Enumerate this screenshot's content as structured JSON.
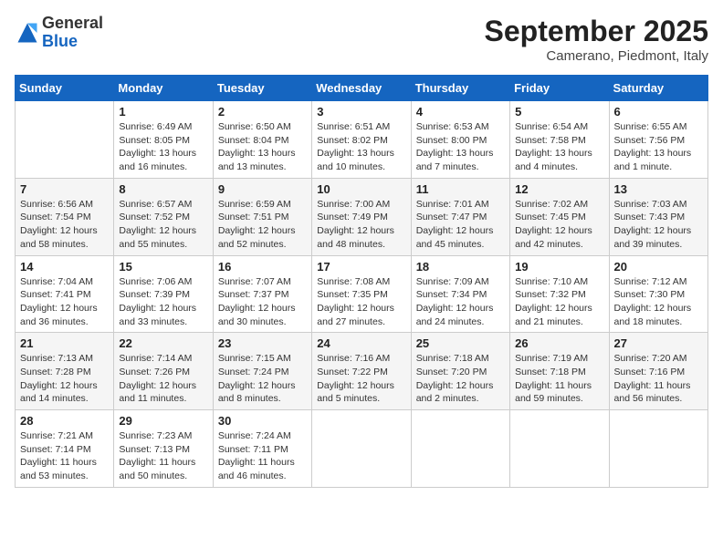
{
  "logo": {
    "general": "General",
    "blue": "Blue"
  },
  "title": "September 2025",
  "location": "Camerano, Piedmont, Italy",
  "days_of_week": [
    "Sunday",
    "Monday",
    "Tuesday",
    "Wednesday",
    "Thursday",
    "Friday",
    "Saturday"
  ],
  "weeks": [
    [
      {
        "num": "",
        "sunrise": "",
        "sunset": "",
        "daylight": ""
      },
      {
        "num": "1",
        "sunrise": "Sunrise: 6:49 AM",
        "sunset": "Sunset: 8:05 PM",
        "daylight": "Daylight: 13 hours and 16 minutes."
      },
      {
        "num": "2",
        "sunrise": "Sunrise: 6:50 AM",
        "sunset": "Sunset: 8:04 PM",
        "daylight": "Daylight: 13 hours and 13 minutes."
      },
      {
        "num": "3",
        "sunrise": "Sunrise: 6:51 AM",
        "sunset": "Sunset: 8:02 PM",
        "daylight": "Daylight: 13 hours and 10 minutes."
      },
      {
        "num": "4",
        "sunrise": "Sunrise: 6:53 AM",
        "sunset": "Sunset: 8:00 PM",
        "daylight": "Daylight: 13 hours and 7 minutes."
      },
      {
        "num": "5",
        "sunrise": "Sunrise: 6:54 AM",
        "sunset": "Sunset: 7:58 PM",
        "daylight": "Daylight: 13 hours and 4 minutes."
      },
      {
        "num": "6",
        "sunrise": "Sunrise: 6:55 AM",
        "sunset": "Sunset: 7:56 PM",
        "daylight": "Daylight: 13 hours and 1 minute."
      }
    ],
    [
      {
        "num": "7",
        "sunrise": "Sunrise: 6:56 AM",
        "sunset": "Sunset: 7:54 PM",
        "daylight": "Daylight: 12 hours and 58 minutes."
      },
      {
        "num": "8",
        "sunrise": "Sunrise: 6:57 AM",
        "sunset": "Sunset: 7:52 PM",
        "daylight": "Daylight: 12 hours and 55 minutes."
      },
      {
        "num": "9",
        "sunrise": "Sunrise: 6:59 AM",
        "sunset": "Sunset: 7:51 PM",
        "daylight": "Daylight: 12 hours and 52 minutes."
      },
      {
        "num": "10",
        "sunrise": "Sunrise: 7:00 AM",
        "sunset": "Sunset: 7:49 PM",
        "daylight": "Daylight: 12 hours and 48 minutes."
      },
      {
        "num": "11",
        "sunrise": "Sunrise: 7:01 AM",
        "sunset": "Sunset: 7:47 PM",
        "daylight": "Daylight: 12 hours and 45 minutes."
      },
      {
        "num": "12",
        "sunrise": "Sunrise: 7:02 AM",
        "sunset": "Sunset: 7:45 PM",
        "daylight": "Daylight: 12 hours and 42 minutes."
      },
      {
        "num": "13",
        "sunrise": "Sunrise: 7:03 AM",
        "sunset": "Sunset: 7:43 PM",
        "daylight": "Daylight: 12 hours and 39 minutes."
      }
    ],
    [
      {
        "num": "14",
        "sunrise": "Sunrise: 7:04 AM",
        "sunset": "Sunset: 7:41 PM",
        "daylight": "Daylight: 12 hours and 36 minutes."
      },
      {
        "num": "15",
        "sunrise": "Sunrise: 7:06 AM",
        "sunset": "Sunset: 7:39 PM",
        "daylight": "Daylight: 12 hours and 33 minutes."
      },
      {
        "num": "16",
        "sunrise": "Sunrise: 7:07 AM",
        "sunset": "Sunset: 7:37 PM",
        "daylight": "Daylight: 12 hours and 30 minutes."
      },
      {
        "num": "17",
        "sunrise": "Sunrise: 7:08 AM",
        "sunset": "Sunset: 7:35 PM",
        "daylight": "Daylight: 12 hours and 27 minutes."
      },
      {
        "num": "18",
        "sunrise": "Sunrise: 7:09 AM",
        "sunset": "Sunset: 7:34 PM",
        "daylight": "Daylight: 12 hours and 24 minutes."
      },
      {
        "num": "19",
        "sunrise": "Sunrise: 7:10 AM",
        "sunset": "Sunset: 7:32 PM",
        "daylight": "Daylight: 12 hours and 21 minutes."
      },
      {
        "num": "20",
        "sunrise": "Sunrise: 7:12 AM",
        "sunset": "Sunset: 7:30 PM",
        "daylight": "Daylight: 12 hours and 18 minutes."
      }
    ],
    [
      {
        "num": "21",
        "sunrise": "Sunrise: 7:13 AM",
        "sunset": "Sunset: 7:28 PM",
        "daylight": "Daylight: 12 hours and 14 minutes."
      },
      {
        "num": "22",
        "sunrise": "Sunrise: 7:14 AM",
        "sunset": "Sunset: 7:26 PM",
        "daylight": "Daylight: 12 hours and 11 minutes."
      },
      {
        "num": "23",
        "sunrise": "Sunrise: 7:15 AM",
        "sunset": "Sunset: 7:24 PM",
        "daylight": "Daylight: 12 hours and 8 minutes."
      },
      {
        "num": "24",
        "sunrise": "Sunrise: 7:16 AM",
        "sunset": "Sunset: 7:22 PM",
        "daylight": "Daylight: 12 hours and 5 minutes."
      },
      {
        "num": "25",
        "sunrise": "Sunrise: 7:18 AM",
        "sunset": "Sunset: 7:20 PM",
        "daylight": "Daylight: 12 hours and 2 minutes."
      },
      {
        "num": "26",
        "sunrise": "Sunrise: 7:19 AM",
        "sunset": "Sunset: 7:18 PM",
        "daylight": "Daylight: 11 hours and 59 minutes."
      },
      {
        "num": "27",
        "sunrise": "Sunrise: 7:20 AM",
        "sunset": "Sunset: 7:16 PM",
        "daylight": "Daylight: 11 hours and 56 minutes."
      }
    ],
    [
      {
        "num": "28",
        "sunrise": "Sunrise: 7:21 AM",
        "sunset": "Sunset: 7:14 PM",
        "daylight": "Daylight: 11 hours and 53 minutes."
      },
      {
        "num": "29",
        "sunrise": "Sunrise: 7:23 AM",
        "sunset": "Sunset: 7:13 PM",
        "daylight": "Daylight: 11 hours and 50 minutes."
      },
      {
        "num": "30",
        "sunrise": "Sunrise: 7:24 AM",
        "sunset": "Sunset: 7:11 PM",
        "daylight": "Daylight: 11 hours and 46 minutes."
      },
      {
        "num": "",
        "sunrise": "",
        "sunset": "",
        "daylight": ""
      },
      {
        "num": "",
        "sunrise": "",
        "sunset": "",
        "daylight": ""
      },
      {
        "num": "",
        "sunrise": "",
        "sunset": "",
        "daylight": ""
      },
      {
        "num": "",
        "sunrise": "",
        "sunset": "",
        "daylight": ""
      }
    ]
  ]
}
